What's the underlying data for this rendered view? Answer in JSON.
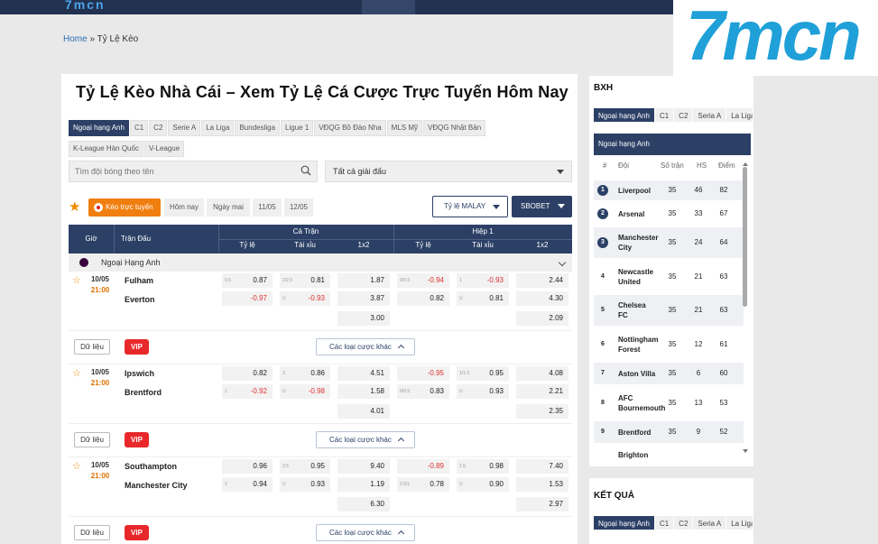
{
  "breadcrumb": {
    "home": "Home",
    "sep": " » ",
    "current": "Tỷ Lệ Kèo"
  },
  "page_title": "Tỷ Lệ Kèo Nhà Cái – Xem Tỷ Lệ Cá Cược Trực Tuyến Hôm Nay",
  "league_tabs": [
    "Ngoại hạng Anh",
    "C1",
    "C2",
    "Serie A",
    "La Liga",
    "Bundesliga",
    "Ligue 1",
    "VĐQG Bồ Đào Nha",
    "MLS Mỹ",
    "VĐQG Nhật Bản",
    "K-League Hàn Quốc",
    "V-League"
  ],
  "search": {
    "placeholder": "Tìm đội bóng theo tên"
  },
  "select_all": "Tất cả giải đấu",
  "filters": {
    "live": "Kèo trực tuyến",
    "today": "Hôm nay",
    "tomorrow": "Ngày mai",
    "d1": "11/05",
    "d2": "12/05"
  },
  "odds_format": "Tỷ lệ MALAY",
  "bookmaker": "SBOBET",
  "table_head": {
    "time": "Giờ",
    "match": "Trận Đấu",
    "fulltime": "Cả Trận",
    "half": "Hiệp 1",
    "hdp": "Tỷ lệ",
    "ou": "Tài xỉu",
    "x12": "1x2"
  },
  "league_name": "Ngoại Hạng Anh",
  "matches": [
    {
      "date": "10/05",
      "time": "21:00",
      "home": "Fulham",
      "away": "Everton",
      "ft_hdp": [
        {
          "h": "0.5",
          "v": "0.87"
        },
        {
          "h": "",
          "v": "-0.97"
        }
      ],
      "ft_ou": [
        {
          "h": "2/2.5",
          "v": "0.81"
        },
        {
          "h": "U",
          "v": "-0.93"
        }
      ],
      "ft_x12": [
        "1.87",
        "3.87",
        "3.00"
      ],
      "h1_hdp": [
        {
          "h": "0/0.5",
          "v": "-0.94"
        },
        {
          "h": "",
          "v": "0.82"
        }
      ],
      "h1_ou": [
        {
          "h": "1",
          "v": "-0.93"
        },
        {
          "h": "U",
          "v": "0.81"
        }
      ],
      "h1_x12": [
        "2.44",
        "4.30",
        "2.09"
      ]
    },
    {
      "date": "10/05",
      "time": "21:00",
      "home": "Ipswich",
      "away": "Brentford",
      "ft_hdp": [
        {
          "h": "",
          "v": "0.82"
        },
        {
          "h": "1",
          "v": "-0.92"
        }
      ],
      "ft_ou": [
        {
          "h": "3",
          "v": "0.86"
        },
        {
          "h": "U",
          "v": "-0.98"
        }
      ],
      "ft_x12": [
        "4.51",
        "1.58",
        "4.01"
      ],
      "h1_hdp": [
        {
          "h": "",
          "v": "-0.95"
        },
        {
          "h": "0/0.5",
          "v": "0.83"
        }
      ],
      "h1_ou": [
        {
          "h": "1/1.5",
          "v": "0.95"
        },
        {
          "h": "U",
          "v": "0.93"
        }
      ],
      "h1_x12": [
        "4.08",
        "2.21",
        "2.35"
      ]
    },
    {
      "date": "10/05",
      "time": "21:00",
      "home": "Southampton",
      "away": "Manchester City",
      "ft_hdp": [
        {
          "h": "",
          "v": "0.96"
        },
        {
          "h": "2",
          "v": "0.94"
        }
      ],
      "ft_ou": [
        {
          "h": "3.5",
          "v": "0.95"
        },
        {
          "h": "U",
          "v": "0.93"
        }
      ],
      "ft_x12": [
        "9.40",
        "1.19",
        "6.30"
      ],
      "h1_hdp": [
        {
          "h": "",
          "v": "-0.89"
        },
        {
          "h": "0.5/1",
          "v": "0.78"
        }
      ],
      "h1_ou": [
        {
          "h": "1.5",
          "v": "0.98"
        },
        {
          "h": "U",
          "v": "0.90"
        }
      ],
      "h1_x12": [
        "7.40",
        "1.53",
        "2.97"
      ]
    }
  ],
  "subrow": {
    "data": "Dữ liệu",
    "vip": "VIP",
    "more": "Các loại cược khác"
  },
  "standings": {
    "title": "BXH",
    "tabs": [
      "Ngoại hạng Anh",
      "C1",
      "C2",
      "Seria A",
      "La Liga"
    ],
    "league": "Ngoại hạng Anh",
    "head": {
      "rank": "#",
      "team": "Đội",
      "played": "Số trận",
      "gd": "HS",
      "pts": "Điểm"
    },
    "rows": [
      {
        "rank": "1",
        "team": "Liverpool",
        "p": "35",
        "gd": "46",
        "pts": "82"
      },
      {
        "rank": "2",
        "team": "Arsenal",
        "p": "35",
        "gd": "33",
        "pts": "67"
      },
      {
        "rank": "3",
        "team": "Manchester City",
        "p": "35",
        "gd": "24",
        "pts": "64"
      },
      {
        "rank": "4",
        "team": "Newcastle United",
        "p": "35",
        "gd": "21",
        "pts": "63"
      },
      {
        "rank": "5",
        "team": "Chelsea FC",
        "p": "35",
        "gd": "21",
        "pts": "63"
      },
      {
        "rank": "6",
        "team": "Nottingham Forest",
        "p": "35",
        "gd": "12",
        "pts": "61"
      },
      {
        "rank": "7",
        "team": "Aston Villa",
        "p": "35",
        "gd": "6",
        "pts": "60"
      },
      {
        "rank": "8",
        "team": "AFC Bournemouth",
        "p": "35",
        "gd": "13",
        "pts": "53"
      },
      {
        "rank": "9",
        "team": "Brentford",
        "p": "35",
        "gd": "9",
        "pts": "52"
      },
      {
        "rank": "",
        "team": "Brighton",
        "p": "",
        "gd": "",
        "pts": ""
      }
    ]
  },
  "results": {
    "title": "KẾT QUẢ",
    "tabs": [
      "Ngoại hạng Anh",
      "C1",
      "C2",
      "Seria A",
      "La Liga"
    ]
  },
  "brand": {
    "text": "7mcn"
  },
  "colors": {
    "navy": "#2c4066",
    "orange": "#f07f10",
    "red": "#e03030",
    "brand": "#1fa0d8"
  }
}
